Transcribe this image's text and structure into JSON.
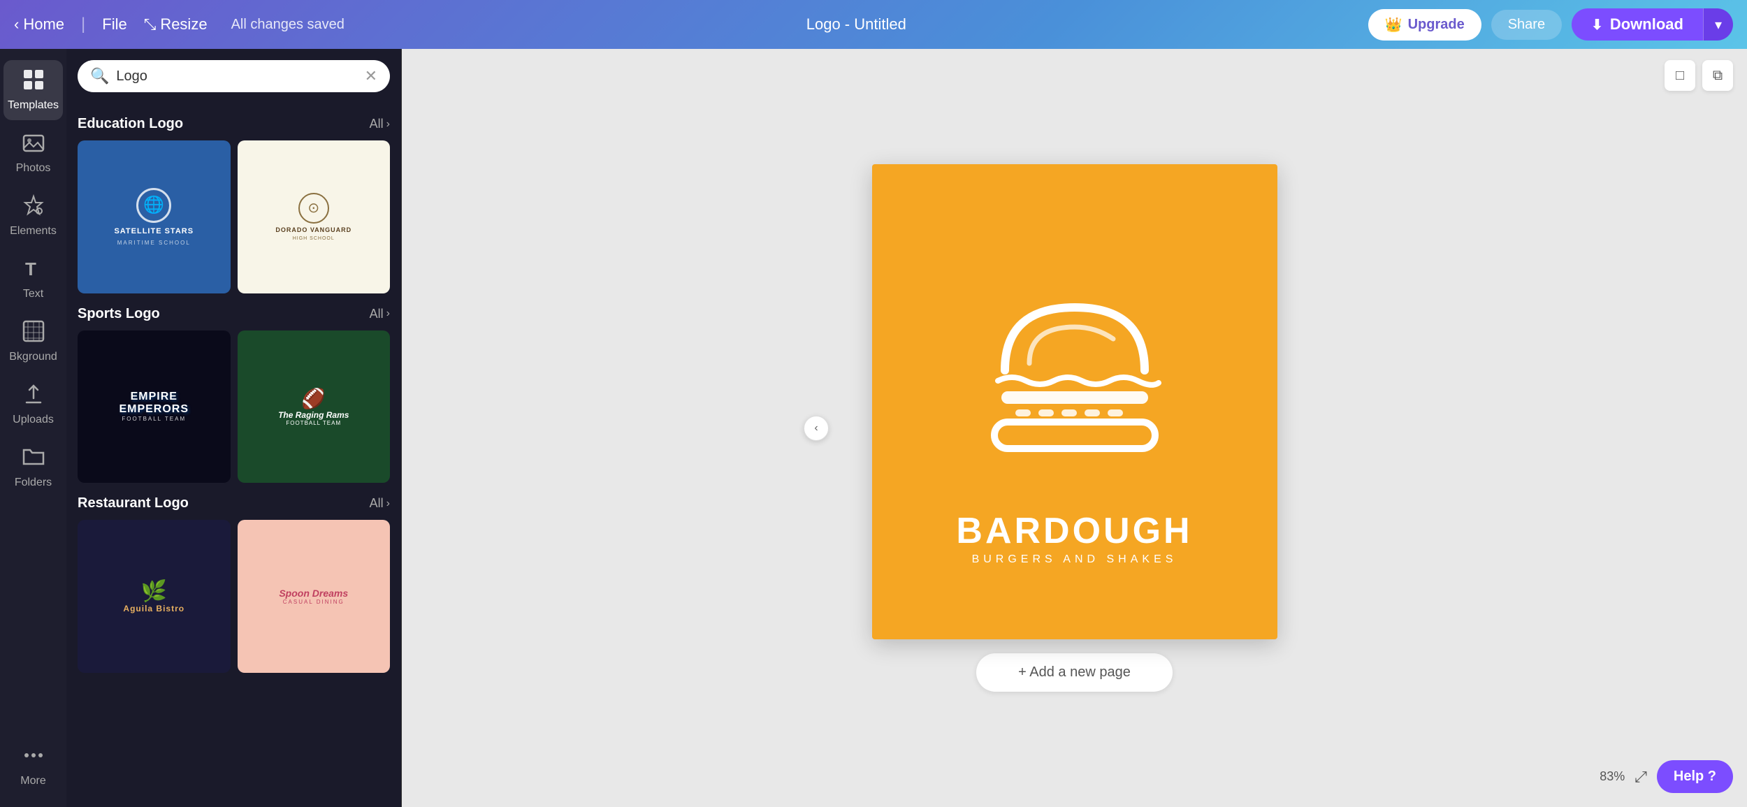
{
  "topbar": {
    "home_label": "Home",
    "file_label": "File",
    "resize_label": "Resize",
    "saved_text": "All changes saved",
    "doc_title": "Logo - Untitled",
    "upgrade_label": "Upgrade",
    "share_label": "Share",
    "download_label": "Download"
  },
  "sidebar": {
    "items": [
      {
        "id": "templates",
        "label": "Templates",
        "icon": "⊞"
      },
      {
        "id": "photos",
        "label": "Photos",
        "icon": "🖼"
      },
      {
        "id": "elements",
        "label": "Elements",
        "icon": "✦"
      },
      {
        "id": "text",
        "label": "Text",
        "icon": "T"
      },
      {
        "id": "background",
        "label": "Bkground",
        "icon": "▦"
      },
      {
        "id": "uploads",
        "label": "Uploads",
        "icon": "↑"
      },
      {
        "id": "folders",
        "label": "Folders",
        "icon": "📁"
      },
      {
        "id": "more",
        "label": "More",
        "icon": "⋯"
      }
    ]
  },
  "search": {
    "placeholder": "Logo",
    "value": "Logo"
  },
  "sections": [
    {
      "id": "education",
      "title": "Education Logo",
      "see_all_label": "All",
      "templates": [
        {
          "id": "edu1",
          "name": "Satellite Stars",
          "sub": "Maritime School",
          "style": "edu1"
        },
        {
          "id": "edu2",
          "name": "Dorado Vanguard",
          "sub": "High School",
          "style": "edu2"
        }
      ]
    },
    {
      "id": "sports",
      "title": "Sports Logo",
      "see_all_label": "All",
      "templates": [
        {
          "id": "sport1",
          "name": "Empire Emperors",
          "sub": "Football Team",
          "style": "sport1"
        },
        {
          "id": "sport2",
          "name": "The Raging Rams",
          "sub": "Football Team",
          "style": "sport2"
        }
      ]
    },
    {
      "id": "restaurant",
      "title": "Restaurant Logo",
      "see_all_label": "All",
      "templates": [
        {
          "id": "rest1",
          "name": "Aguila Bistro",
          "sub": "",
          "style": "rest1"
        },
        {
          "id": "rest2",
          "name": "Spoon Dreams",
          "sub": "Casual Dining",
          "style": "rest2"
        }
      ]
    }
  ],
  "canvas": {
    "brand_name": "BARDOUGH",
    "brand_sub": "BURGERS AND SHAKES",
    "add_page_label": "+ Add a new page",
    "zoom_level": "83%"
  },
  "help_btn": "Help ?",
  "canvas_tools": [
    {
      "id": "notes",
      "icon": "🗒"
    },
    {
      "id": "copy",
      "icon": "⧉"
    }
  ]
}
